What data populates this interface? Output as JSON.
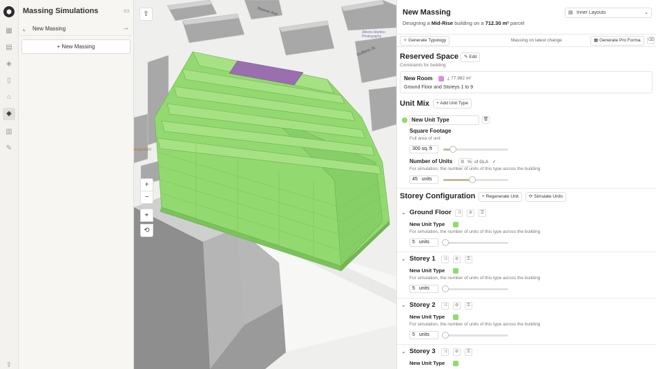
{
  "sidebar": {
    "title": "Massing Simulations",
    "items": [
      {
        "label": "New Massing"
      }
    ],
    "new_button": "+ New Massing"
  },
  "map": {
    "streets": [
      "Beaver Ave",
      "Dufferin St",
      "Alberto Martino Photography",
      "estaurant"
    ],
    "zoom_in": "+",
    "zoom_out": "−"
  },
  "panel": {
    "title": "New Massing",
    "subtitle_prefix": "Designing a",
    "subtitle_type": "Mid-Rise",
    "subtitle_mid": "building on a",
    "subtitle_area": "712.30 m²",
    "subtitle_suffix": "parcel",
    "layouts_select": "Inner Layouts",
    "toolbar": {
      "generate_typology": "Generate Typology",
      "status": "Massing on latest change",
      "generate_pro_forma": "Generate Pro Forma"
    },
    "reserved_space": {
      "title": "Reserved Space",
      "edit": "Edit",
      "description": "Constraints for building",
      "room_name": "New Room",
      "room_area": "77.982 m²",
      "room_floors": "Ground Floor and Storeys 1 to 9",
      "room_color": "#e08be0"
    },
    "unit_mix": {
      "title": "Unit Mix",
      "add_button": "+ Add Unit Type",
      "unit_name": "New Unit Type",
      "unit_color": "#8fdc6e",
      "square_footage_label": "Square Footage",
      "square_footage_desc": "Full area of unit",
      "square_footage_value": "300 sq. ft",
      "square_footage_fraction": 0.15,
      "num_units_label": "Number of Units",
      "gla_percent": "0",
      "gla_percent_unit": "%",
      "gla_label": "of GLA",
      "num_units_desc": "For simulation, the number of units of this type across the building",
      "num_units_value": "45",
      "num_units_unit": "units",
      "num_units_fraction": 0.45
    },
    "storey_config": {
      "title": "Storey Configuration",
      "regenerate": "Regenerate Unit",
      "simulate": "Simulate Units",
      "storeys": [
        {
          "name": "Ground Floor",
          "unit_type": "New Unit Type",
          "desc": "For simulation, the number of units of this type across the building",
          "value": "5",
          "unit": "units"
        },
        {
          "name": "Storey 1",
          "unit_type": "New Unit Type",
          "desc": "For simulation, the number of units of this type across the building",
          "value": "5",
          "unit": "units"
        },
        {
          "name": "Storey 2",
          "unit_type": "New Unit Type",
          "desc": "For simulation, the number of units of this type across the building",
          "value": "5",
          "unit": "units"
        },
        {
          "name": "Storey 3",
          "unit_type": "New Unit Type"
        }
      ]
    }
  },
  "colors": {
    "building_green": "#8fdc6e",
    "reserved_purple": "#9a6fb0",
    "context_grey": "#9d9d9d"
  }
}
